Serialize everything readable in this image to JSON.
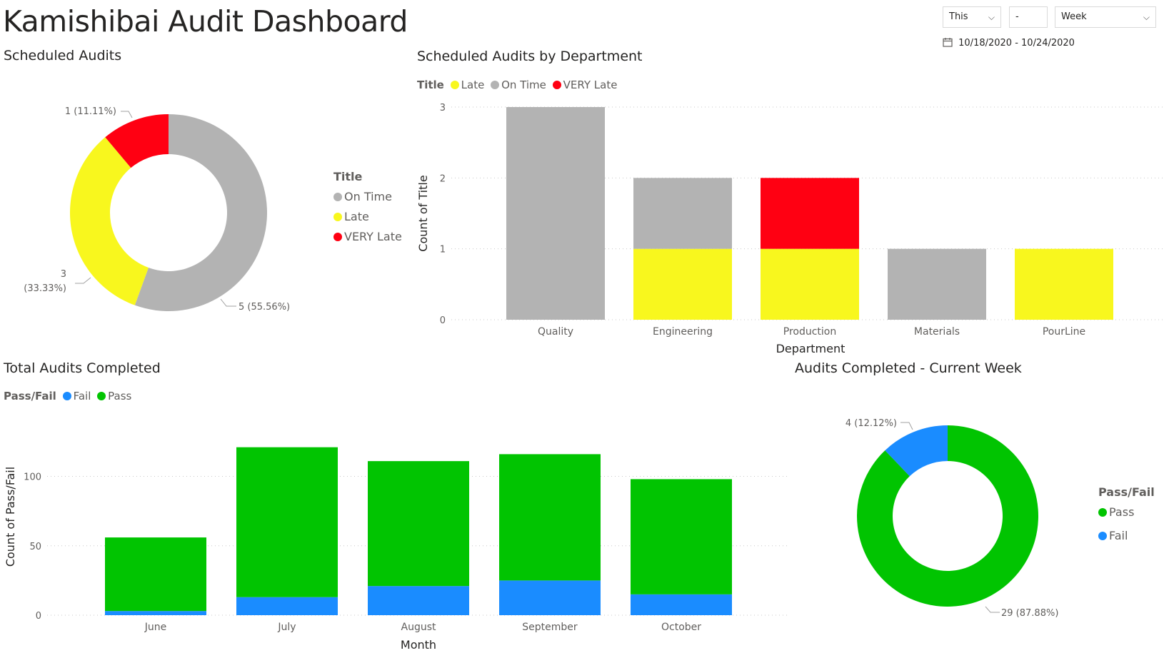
{
  "page": {
    "title": "Kamishibai Audit Dashboard"
  },
  "slicers": {
    "relative": "This",
    "number": "-",
    "period": "Week",
    "date_range": "10/18/2020 - 10/24/2020"
  },
  "colors": {
    "on_time": "#b3b3b3",
    "late": "#f8f71e",
    "very_late": "#ff0012",
    "pass": "#01c401",
    "fail": "#1a8cff"
  },
  "icons": {
    "calendar": "calendar-icon",
    "dropdown": "chevron-down-icon"
  },
  "chart_data": [
    {
      "id": "scheduled_audits",
      "type": "pie",
      "title": "Scheduled Audits",
      "legend_title": "Title",
      "legend_position": "right",
      "slices": [
        {
          "name": "On Time",
          "value": 5,
          "label": "5 (55.56%)",
          "color": "#b3b3b3"
        },
        {
          "name": "Late",
          "value": 3,
          "label": "3 (33.33%)",
          "color": "#f8f71e"
        },
        {
          "name": "VERY Late",
          "value": 1,
          "label": "1 (11.11%)",
          "color": "#ff0012"
        }
      ]
    },
    {
      "id": "by_department",
      "type": "bar",
      "stacked": true,
      "title": "Scheduled Audits by Department",
      "legend_title": "Title",
      "legend_position": "top-left",
      "xlabel": "Department",
      "ylabel": "Count of Title",
      "ylim": [
        0,
        3
      ],
      "yticks": [
        0,
        1,
        2,
        3
      ],
      "categories": [
        "Quality",
        "Engineering",
        "Production",
        "Materials",
        "PourLine"
      ],
      "series": [
        {
          "name": "Late",
          "color": "#f8f71e",
          "values": [
            0,
            1,
            1,
            0,
            1
          ]
        },
        {
          "name": "On Time",
          "color": "#b3b3b3",
          "values": [
            3,
            1,
            0,
            1,
            0
          ]
        },
        {
          "name": "VERY Late",
          "color": "#ff0012",
          "values": [
            0,
            0,
            1,
            0,
            0
          ]
        }
      ],
      "stack_order": [
        "Late",
        "VERY Late",
        "On Time"
      ]
    },
    {
      "id": "total_completed",
      "type": "bar",
      "stacked": true,
      "title": "Total Audits Completed",
      "legend_title": "Pass/Fail",
      "legend_position": "top-left",
      "xlabel": "Month",
      "ylabel": "Count of Pass/Fail",
      "ylim": [
        0,
        127
      ],
      "yticks": [
        0,
        50,
        100
      ],
      "categories": [
        "June",
        "July",
        "August",
        "September",
        "October"
      ],
      "series": [
        {
          "name": "Fail",
          "color": "#1a8cff",
          "values": [
            3,
            13,
            21,
            25,
            15
          ]
        },
        {
          "name": "Pass",
          "color": "#01c401",
          "values": [
            53,
            108,
            90,
            91,
            83
          ]
        }
      ]
    },
    {
      "id": "current_week",
      "type": "pie",
      "title": "Audits Completed - Current Week",
      "legend_title": "Pass/Fail",
      "legend_position": "right",
      "slices": [
        {
          "name": "Pass",
          "value": 29,
          "label": "29 (87.88%)",
          "color": "#01c401"
        },
        {
          "name": "Fail",
          "value": 4,
          "label": "4 (12.12%)",
          "color": "#1a8cff"
        }
      ]
    }
  ]
}
